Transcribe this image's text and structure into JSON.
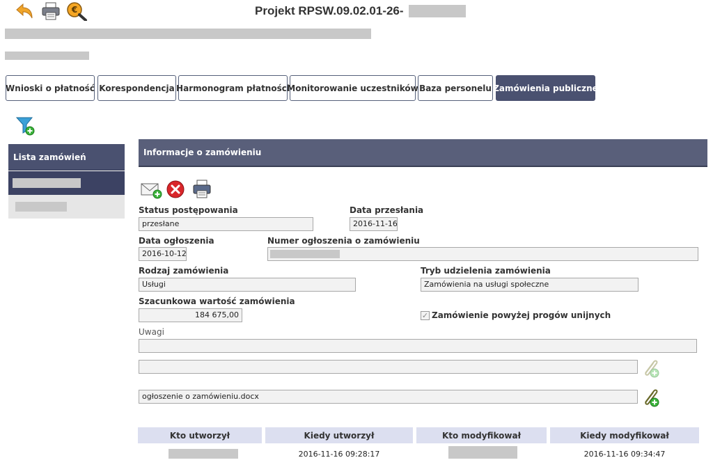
{
  "header": {
    "title": "Projekt RPSW.09.02.01-26-",
    "icons": [
      "back-arrow-icon",
      "printer-icon",
      "euro-search-icon"
    ]
  },
  "tabs": [
    {
      "label": "Wnioski o płatność",
      "active": false
    },
    {
      "label": "Korespondencja",
      "active": false
    },
    {
      "label": "Harmonogram płatności",
      "active": false
    },
    {
      "label": "Monitorowanie uczestników",
      "active": false
    },
    {
      "label": "Baza personelu",
      "active": false
    },
    {
      "label": "Zamówienia publiczne",
      "active": true
    }
  ],
  "sidebar": {
    "heading": "Lista zamówień"
  },
  "section": {
    "title": "Informacje o zamówieniu"
  },
  "form": {
    "status_label": "Status postępowania",
    "status_value": "przesłane",
    "sent_date_label": "Data przesłania",
    "sent_date_value": "2016-11-16",
    "announce_date_label": "Data ogłoszenia",
    "announce_date_value": "2016-10-12",
    "announce_number_label": "Numer ogłoszenia o zamówieniu",
    "type_label": "Rodzaj zamówienia",
    "type_value": "Usługi",
    "mode_label": "Tryb udzielenia zamówienia",
    "mode_value": "Zamówienia na usługi społeczne",
    "value_label": "Szacunkowa wartość zamówienia",
    "value_value": "184 675,00",
    "eu_threshold_label": "Zamówienie powyżej progów unijnych",
    "eu_threshold_checked": true,
    "notes_label": "Uwagi",
    "notes_value": "",
    "attachment1_value": "",
    "attachment2_value": "ogłoszenie o zamówieniu.docx"
  },
  "audit_table": {
    "headers": [
      "Kto utworzył",
      "Kiedy utworzył",
      "Kto modyfikował",
      "Kiedy modyfikował"
    ],
    "row": {
      "created_at": "2016-11-16 09:28:17",
      "modified_at": "2016-11-16 09:34:47"
    }
  },
  "colors": {
    "accent": "#4a5170",
    "section_header": "#595f7a",
    "table_header": "#dcdff0"
  }
}
